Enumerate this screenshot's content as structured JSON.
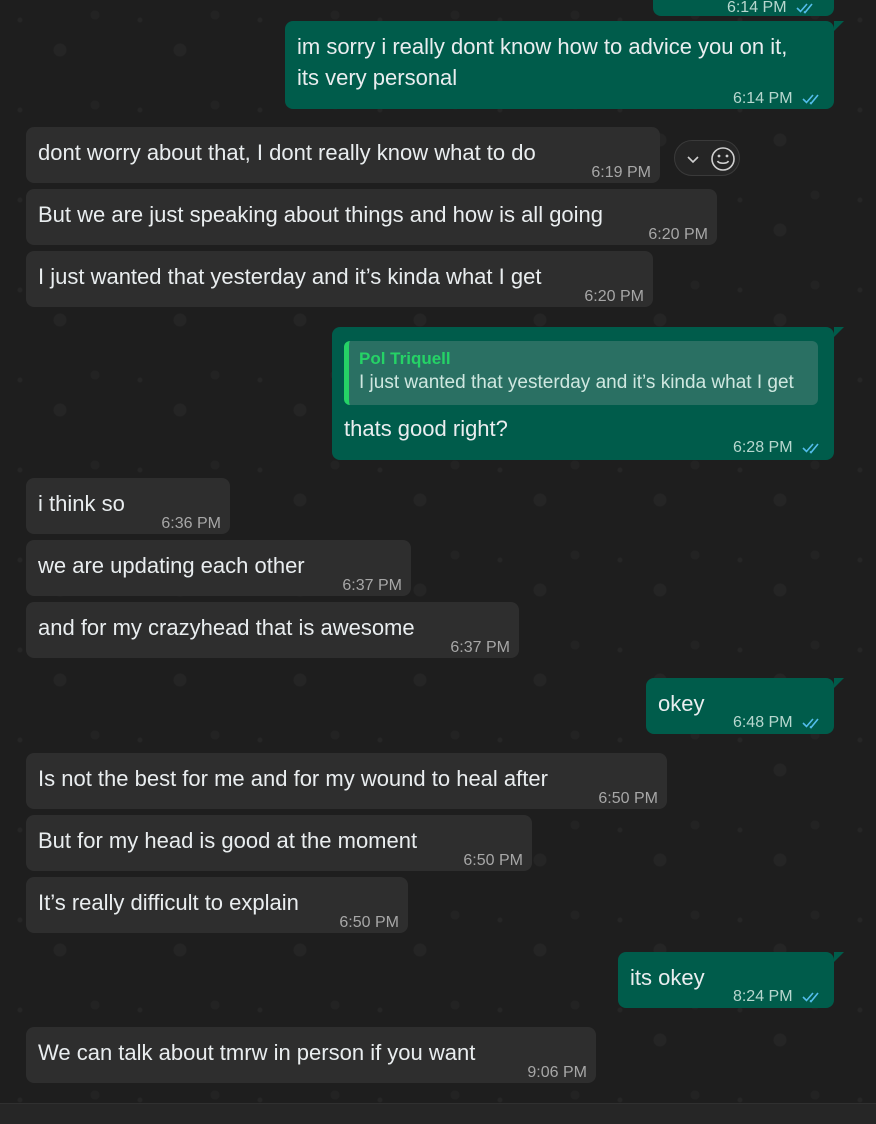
{
  "theme": {
    "incoming_bubble": "#2e2e2e",
    "outgoing_bubble": "#005c4b",
    "read_ticks": "#53bdeb",
    "quote_accent": "#25d366"
  },
  "messages": [
    {
      "text": "",
      "time": "6:14 PM",
      "dir": "out"
    },
    {
      "text": "im sorry i really dont know how to advice you on it,",
      "text2": "its very personal",
      "time": "6:14 PM",
      "dir": "out"
    },
    {
      "text": "dont worry about that, I dont really know what to do",
      "time": "6:19 PM",
      "dir": "in"
    },
    {
      "text": "But we are just speaking about things and how is all going",
      "time": "6:20 PM",
      "dir": "in"
    },
    {
      "text": "I just wanted that yesterday and it’s kinda what I get",
      "time": "6:20 PM",
      "dir": "in"
    },
    {
      "text": "thats good right?",
      "time": "6:28 PM",
      "dir": "out",
      "reply": {
        "sender": "Pol Triquell",
        "text": "I just wanted that yesterday and it’s kinda what I get"
      }
    },
    {
      "text": "i think so",
      "time": "6:36 PM",
      "dir": "in"
    },
    {
      "text": "we are updating each other",
      "time": "6:37 PM",
      "dir": "in"
    },
    {
      "text": "and for my crazyhead that is awesome",
      "time": "6:37 PM",
      "dir": "in"
    },
    {
      "text": "okey",
      "time": "6:48 PM",
      "dir": "out"
    },
    {
      "text": "Is not the best for me and for my wound to heal after",
      "time": "6:50 PM",
      "dir": "in"
    },
    {
      "text": "But for my head is good at the moment",
      "time": "6:50 PM",
      "dir": "in"
    },
    {
      "text": "It’s really difficult to explain",
      "time": "6:50 PM",
      "dir": "in"
    },
    {
      "text": "its okey",
      "time": "8:24 PM",
      "dir": "out"
    },
    {
      "text": "We can talk about tmrw in person  if you want",
      "time": "9:06 PM",
      "dir": "in"
    }
  ],
  "hover_menu": {
    "icons": [
      "chevron-down-icon",
      "emoji-icon"
    ]
  }
}
